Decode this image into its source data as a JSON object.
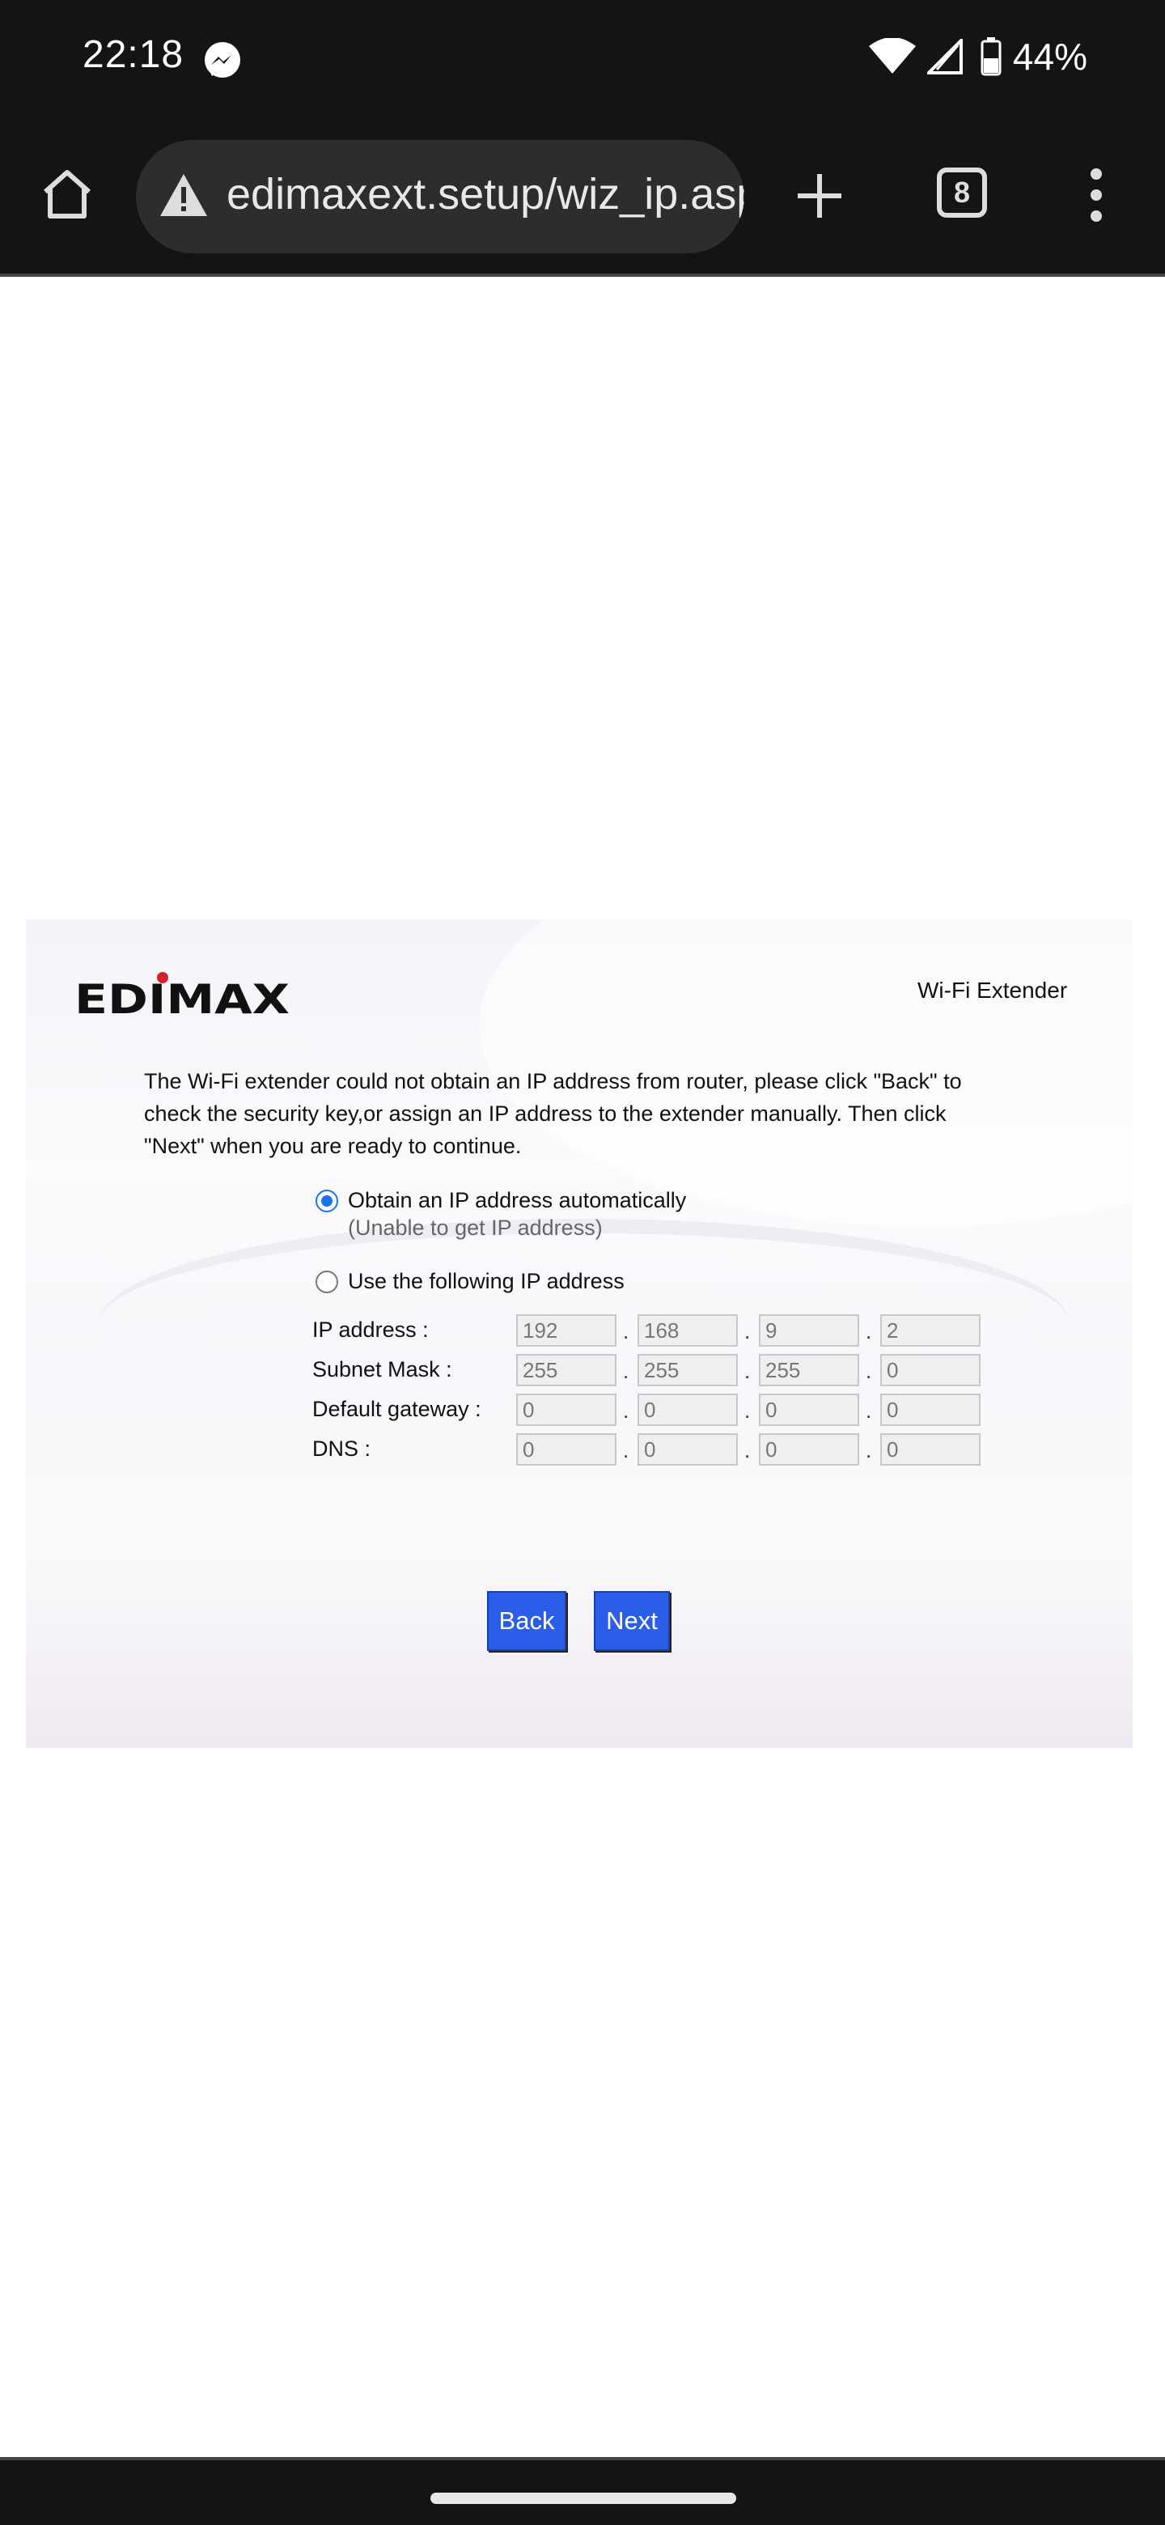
{
  "status_bar": {
    "time": "22:18",
    "battery": "44%",
    "icons": [
      "messenger-icon",
      "wifi-icon",
      "cell-signal-icon",
      "battery-icon"
    ]
  },
  "browser": {
    "url": "edimaxext.setup/wiz_ip.asp",
    "tab_count": "8",
    "icons": [
      "home-icon",
      "warning-icon",
      "new-tab-icon",
      "tab-switcher-icon",
      "more-menu-icon"
    ]
  },
  "page": {
    "logo_text": "EDIMAX",
    "product": "Wi-Fi Extender",
    "message": "The Wi-Fi extender could not obtain an IP address from router, please click \"Back\" to check the security key,or assign an IP address to the extender manually. Then click \"Next\" when you are ready to continue.",
    "option_auto": {
      "label": "Obtain an IP address automatically",
      "sublabel": "(Unable to get IP address)",
      "selected": true
    },
    "option_manual": {
      "label": "Use the following IP address",
      "selected": false
    },
    "fields": [
      {
        "label": "IP address :",
        "values": [
          "192",
          "168",
          "9",
          "2"
        ]
      },
      {
        "label": "Subnet Mask :",
        "values": [
          "255",
          "255",
          "255",
          "0"
        ]
      },
      {
        "label": "Default gateway :",
        "values": [
          "0",
          "0",
          "0",
          "0"
        ]
      },
      {
        "label": "DNS :",
        "values": [
          "0",
          "0",
          "0",
          "0"
        ]
      }
    ],
    "back_label": "Back",
    "next_label": "Next",
    "accent_color": "#2a5de8"
  }
}
